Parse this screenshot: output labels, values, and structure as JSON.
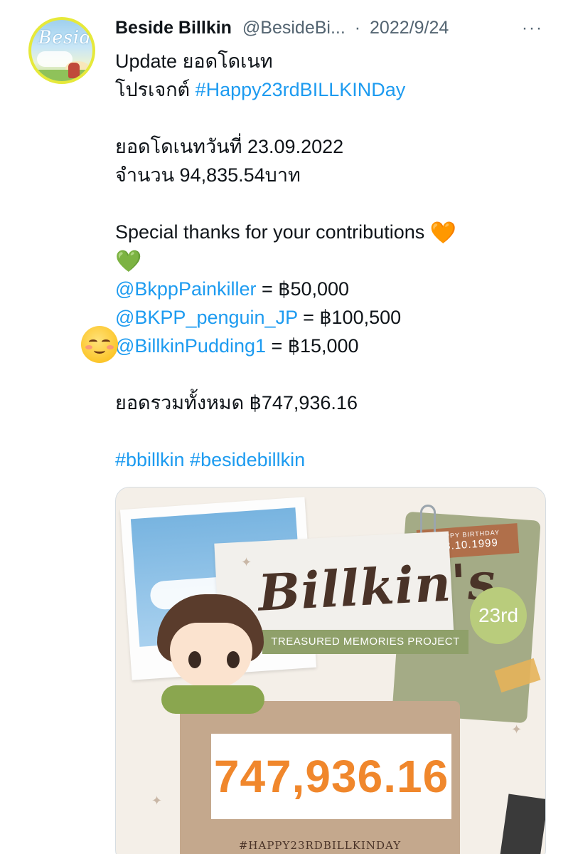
{
  "avatar": {
    "label": "Beside"
  },
  "header": {
    "display_name": "Beside Billkin",
    "handle": "@BesideBi...",
    "separator": "·",
    "date": "2022/9/24",
    "more_icon": "more-icon",
    "more_glyph": "···"
  },
  "tweet": {
    "line1": "Update ยอดโดเนท",
    "line2_prefix": "โปรเจกต์ ",
    "line2_hashtag": "#Happy23rdBILLKINDay",
    "line3": "ยอดโดเนทวันที่ 23.09.2022",
    "line4": "จำนวน 94,835.54บาท",
    "line5": "Special thanks for your contributions ",
    "orange_heart": "🧡",
    "green_heart": "💚",
    "contributors": [
      {
        "mention": "@BkppPainkiller",
        "amount": " = ฿50,000"
      },
      {
        "mention": "@BKPP_penguin_JP",
        "amount": " = ฿100,500"
      },
      {
        "mention": "@BillkinPudding1",
        "amount": " = ฿15,000"
      }
    ],
    "total_line": "ยอดรวมทั้งหมด ฿747,936.16",
    "hashtags": "#bbillkin #besidebillkin"
  },
  "media": {
    "birthday_label": "HAPPY BIRTHDAY",
    "birthday_date": "08.10.1999",
    "title": "Billkin's",
    "banner": "TREASURED MEMORIES PROJECT",
    "age": "23rd",
    "total": "747,936.16",
    "hashtag": "#HAPPY23RDBILLKINDAY"
  },
  "colors": {
    "link": "#1d9bf0",
    "secondary_text": "#536471",
    "total_orange": "#f0872c"
  }
}
